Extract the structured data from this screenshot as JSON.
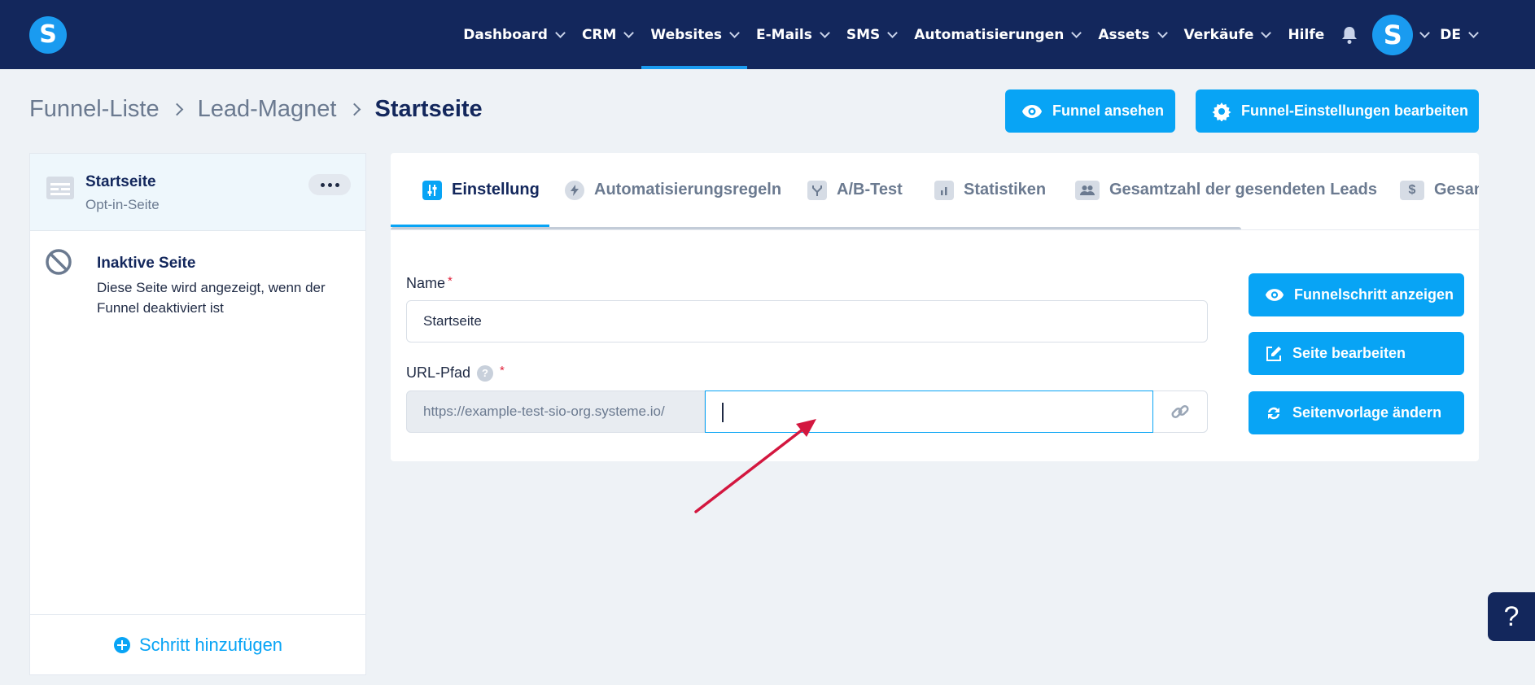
{
  "app": {
    "logo_letter": "S",
    "language": "DE",
    "avatar_letter": "S"
  },
  "nav": {
    "items": [
      {
        "label": "Dashboard",
        "has_menu": true,
        "active": false
      },
      {
        "label": "CRM",
        "has_menu": true,
        "active": false
      },
      {
        "label": "Websites",
        "has_menu": true,
        "active": true
      },
      {
        "label": "E-Mails",
        "has_menu": true,
        "active": false
      },
      {
        "label": "SMS",
        "has_menu": true,
        "active": false
      },
      {
        "label": "Automatisierungen",
        "has_menu": true,
        "active": false
      },
      {
        "label": "Assets",
        "has_menu": true,
        "active": false
      },
      {
        "label": "Verkäufe",
        "has_menu": true,
        "active": false
      },
      {
        "label": "Hilfe",
        "has_menu": false,
        "active": false
      }
    ]
  },
  "breadcrumb": [
    "Funnel-Liste",
    "Lead-Magnet",
    "Startseite"
  ],
  "header_buttons": {
    "view_funnel": "Funnel ansehen",
    "edit_funnel_settings": "Funnel-Einstellungen bearbeiten"
  },
  "sidebar": {
    "step": {
      "title": "Startseite",
      "subtitle": "Opt-in-Seite"
    },
    "inactive": {
      "title": "Inaktive Seite",
      "description": "Diese Seite wird angezeigt, wenn der Funnel deaktiviert ist"
    },
    "add_step": "Schritt hinzufügen"
  },
  "tabs": [
    {
      "label": "Einstellung",
      "icon": "sliders-icon",
      "active": true
    },
    {
      "label": "Automatisierungsregeln",
      "icon": "bolt-icon",
      "active": false
    },
    {
      "label": "A/B-Test",
      "icon": "split-icon",
      "active": false
    },
    {
      "label": "Statistiken",
      "icon": "bar-chart-icon",
      "active": false
    },
    {
      "label": "Gesamtzahl der gesendeten Leads",
      "icon": "users-icon",
      "active": false
    },
    {
      "label": "Gesamt",
      "icon": "dollar-icon",
      "active": false
    }
  ],
  "form": {
    "name_label": "Name",
    "name_value": "Startseite",
    "url_label": "URL-Pfad",
    "url_help": "?",
    "url_prefix": "https://example-test-sio-org.systeme.io/",
    "url_value": ""
  },
  "action_buttons": {
    "show_step": "Funnelschritt anzeigen",
    "edit_page": "Seite bearbeiten",
    "change_template": "Seitenvorlage ändern"
  },
  "help_float": "?",
  "colors": {
    "nav_bg": "#13275c",
    "accent": "#08a4f5",
    "required": "#e0223b",
    "annotation_arrow": "#d3173f"
  }
}
